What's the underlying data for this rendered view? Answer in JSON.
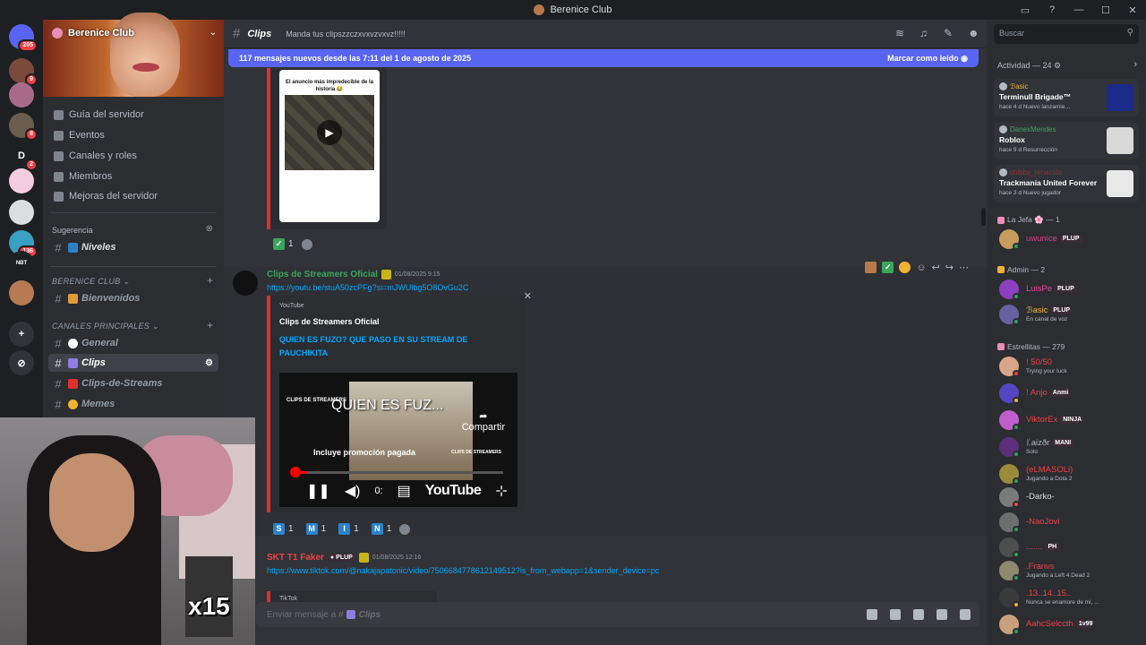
{
  "window": {
    "title": "Berenice Club"
  },
  "servers": [
    {
      "letter": "",
      "color": "#5865f2",
      "badge": "205"
    },
    {
      "letter": "",
      "color": "#7a4b3b",
      "badge": "9"
    },
    {
      "letter": "",
      "color": "#a86a8a",
      "badge": ""
    },
    {
      "letter": "",
      "color": "#6b5d4e",
      "badge": "8"
    },
    {
      "letter": "D",
      "color": "#1e1f22",
      "badge": "2"
    },
    {
      "letter": "",
      "color": "#f5cde0",
      "badge": ""
    },
    {
      "letter": "",
      "color": "#dbdee1",
      "badge": ""
    },
    {
      "letter": "",
      "color": "#3aa0c2",
      "badge": "136"
    },
    {
      "letter": "NBT",
      "color": "#1e1f22",
      "badge": ""
    },
    {
      "letter": "",
      "color": "#b77a52",
      "badge": ""
    }
  ],
  "sidebar": {
    "server_name": "Berenice Club",
    "menu": [
      "Guía del servidor",
      "Eventos",
      "Canales y roles",
      "Miembros",
      "Mejoras del servidor"
    ],
    "suggestion_label": "Sugerencia",
    "suggestion_channel": "Niveles",
    "categories": [
      {
        "name": "BERENICE CLUB",
        "channels": [
          {
            "name": "Bienvenidos",
            "emoji_color": "#e09a3c"
          }
        ]
      },
      {
        "name": "CANALES PRINCIPALES",
        "channels": [
          {
            "name": "General",
            "emoji_color": "#ffffff"
          },
          {
            "name": "Clips",
            "emoji_color": "#8f7de2"
          },
          {
            "name": "Clips-de-Streams",
            "emoji_color": "#e02f2f"
          },
          {
            "name": "Memes",
            "emoji_color": "#f0b232"
          }
        ]
      }
    ]
  },
  "webcam": {
    "overlay_text": "x15"
  },
  "header": {
    "channel": "Clips",
    "topic": "Manda tus clipszzczxvxvzvxvz!!!!!"
  },
  "new_bar": {
    "text": "117 mensajes nuevos desde las 7:11 del 1 de agosto de 2025",
    "action": "Marcar como leído"
  },
  "messages": {
    "first": {
      "embed_title": "El anuncio más impredecible de la historia 😂",
      "reaction_count": "1"
    },
    "second": {
      "author": "Clips de Streamers Oficial",
      "time": "01/08/2025 9:15",
      "link": "https://youtu.be/stuA50zcPFg?si=mJWUlbg5O8OvGu2C",
      "embed_provider": "YouTube",
      "embed_author": "Clips de Streamers Oficial",
      "embed_title": "QUIEN ES FUZO? QUE PASO EN SU STREAM DE PAUCHIKITA",
      "video_title": "QUIEN ES FUZ...",
      "share": "Compartir",
      "promo": "Incluye promoción pagada",
      "time_code": "0:",
      "yt_logo": "YouTube",
      "channel_logo": "CLIPS DE STREAMERS",
      "progress": 0.07,
      "reactions": [
        {
          "letter": "S",
          "count": "1",
          "color": "#2b82c9"
        },
        {
          "letter": "M",
          "count": "1",
          "color": "#2b82c9"
        },
        {
          "letter": "I",
          "count": "1",
          "color": "#2b82c9"
        },
        {
          "letter": "N",
          "count": "1",
          "color": "#2b82c9"
        }
      ]
    },
    "third": {
      "author": "SKT T1 Faker",
      "role": "PLUP",
      "time": "01/08/2025 12:16",
      "link": "https://www.tiktok.com/@nakajapatonic/video/7506684778612149512?is_from_webapp=1&sender_device=pc",
      "embed_provider": "TikTok"
    }
  },
  "composer": {
    "placeholder": "Enviar mensaje a #",
    "channel": "Clips"
  },
  "right": {
    "search_placeholder": "Buscar",
    "activity_header": "Actividad — 24",
    "activities": [
      {
        "user": "ℬasic",
        "user_color": "#f0b232",
        "game": "Terminull Brigade™",
        "meta": "hace 4 d   Nuevo lanzamie…",
        "thumb_color": "#1b2b8a"
      },
      {
        "user": "DanexMendes",
        "user_color": "#3ba55c",
        "game": "Roblox",
        "meta": "hace 9 d   Resurrección",
        "thumb_color": "#d9d9d9"
      },
      {
        "user": "chibby_renacido",
        "user_color": "#8e2f3a",
        "game": "Trackmania United Forever",
        "meta": "hace 3 d   Nuevo jugador",
        "thumb_color": "#e8e8e8"
      }
    ],
    "groups": [
      {
        "title": "La Jefa 🌸 — 1",
        "members": [
          {
            "name": "uwunice",
            "color": "#e2398a",
            "badge": "PLUP",
            "sub": "",
            "av": "#c79c5e",
            "status": "#23a55a"
          }
        ]
      },
      {
        "title": "Admin — 2",
        "members": [
          {
            "name": "LuisPe",
            "color": "#eb459e",
            "badge": "PLUP",
            "sub": "",
            "av": "#8e3fbf",
            "status": "#23a55a"
          },
          {
            "name": "ℬasic",
            "color": "#f0b232",
            "badge": "PLUP",
            "sub": "En canal de voz",
            "av": "#6a5fa0",
            "status": "#23a55a"
          }
        ]
      },
      {
        "title": "Estrellitas — 279",
        "members": [
          {
            "name": "! 50/50",
            "color": "#ed4245",
            "badge": "",
            "sub": "Trying your luck",
            "av": "#d8a589",
            "status": "#f23f43"
          },
          {
            "name": "! Anjo",
            "color": "#ed4245",
            "badge": "Anmi",
            "sub": "",
            "av": "#5446c2",
            "status": "#f0b232"
          },
          {
            "name": "ViktorEx",
            "color": "#ed4245",
            "badge": "NINJA",
            "sub": "",
            "av": "#c05fcc",
            "status": "#23a55a"
          },
          {
            "name": "ᛕaizðr",
            "color": "#b5bac1",
            "badge": "MANI",
            "sub": "Solo",
            "av": "#5b2f7a",
            "status": "#23a55a"
          },
          {
            "name": "(eLMASOLi)",
            "color": "#ed4245",
            "badge": "",
            "sub": "Jugando a Dota 2",
            "av": "#9a8b3c",
            "status": "#23a55a"
          },
          {
            "name": "-Darko-",
            "color": "#dbdee1",
            "badge": "",
            "sub": "",
            "av": "#7a7a7a",
            "status": "#f23f43"
          },
          {
            "name": "-NaoJovi",
            "color": "#ed4245",
            "badge": "",
            "sub": "",
            "av": "#6e6e6e",
            "status": "#23a55a"
          },
          {
            "name": ".......",
            "color": "#ed4245",
            "badge": "PH",
            "sub": "",
            "av": "#4d4d4d",
            "status": "#23a55a"
          },
          {
            "name": ".Franvs",
            "color": "#ed4245",
            "badge": "",
            "sub": "Jugando a Left 4 Dead 2",
            "av": "#8f8a6e",
            "status": "#23a55a"
          },
          {
            "name": ".13..14..15..",
            "color": "#ed4245",
            "badge": "",
            "sub": "Nunca se enamore de mi, ...",
            "av": "#3a3a3a",
            "status": "#f0b232"
          },
          {
            "name": "AahcSelccth",
            "color": "#ed4245",
            "badge": "1v99",
            "sub": "",
            "av": "#c9a07e",
            "status": "#23a55a"
          }
        ]
      }
    ]
  }
}
